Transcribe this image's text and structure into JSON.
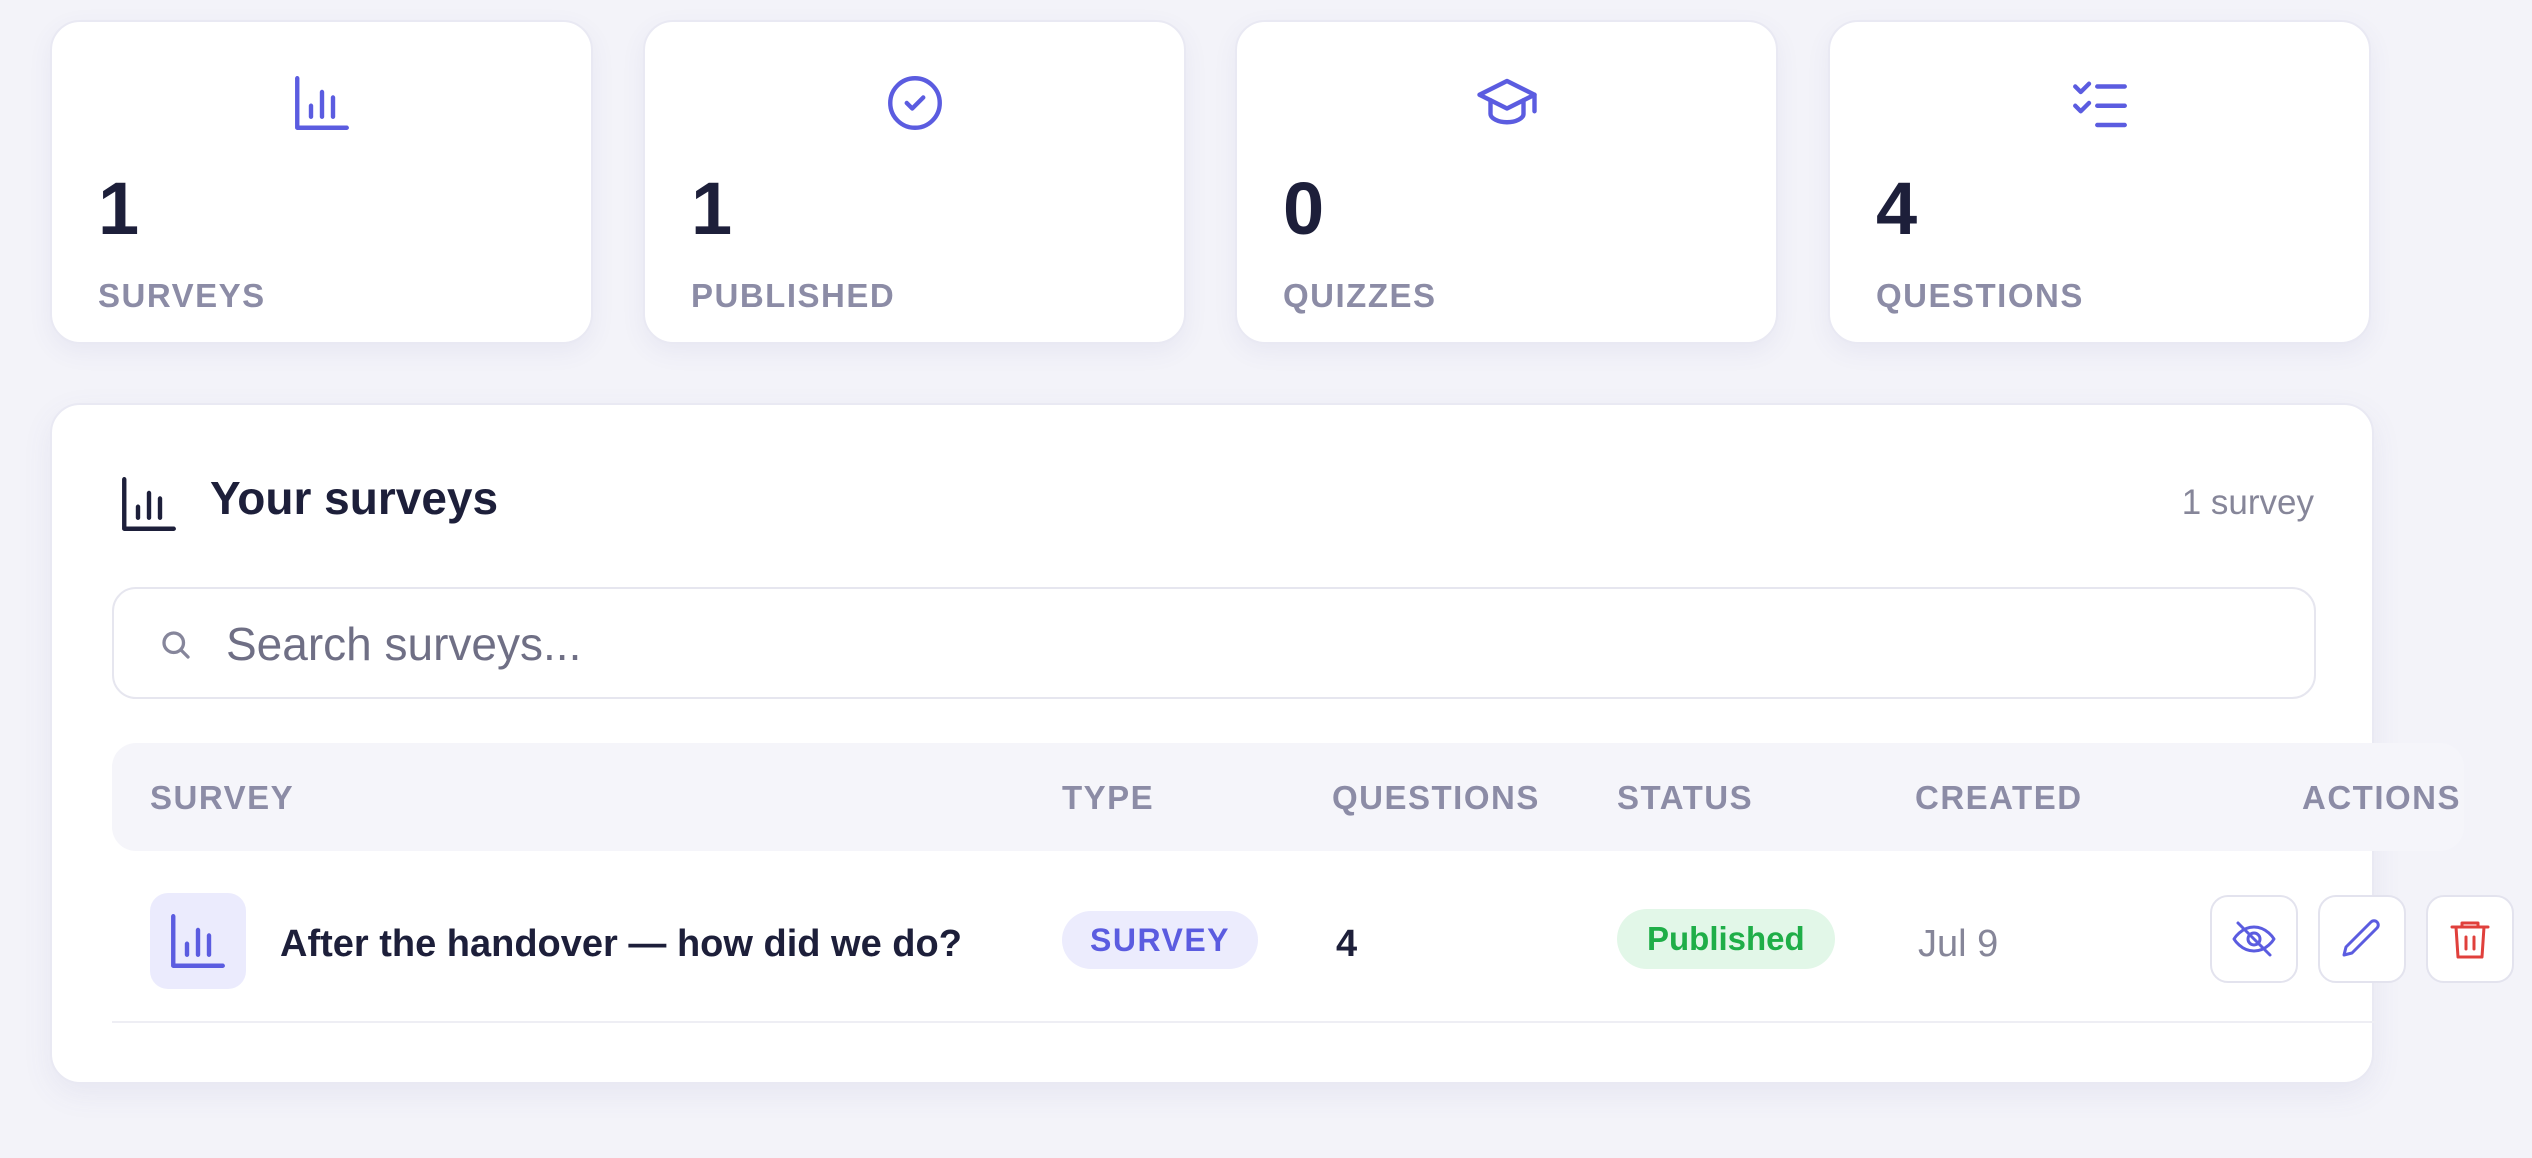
{
  "stats": [
    {
      "value": "1",
      "label": "SURVEYS",
      "icon": "bar-chart-icon"
    },
    {
      "value": "1",
      "label": "PUBLISHED",
      "icon": "check-circle-icon"
    },
    {
      "value": "0",
      "label": "QUIZZES",
      "icon": "graduation-cap-icon"
    },
    {
      "value": "4",
      "label": "QUESTIONS",
      "icon": "checklist-icon"
    }
  ],
  "panel": {
    "title": "Your surveys",
    "count": "1 survey",
    "icon": "bar-chart-icon"
  },
  "search": {
    "placeholder": "Search surveys...",
    "value": "",
    "icon": "search-icon"
  },
  "table": {
    "columns": [
      "SURVEY",
      "TYPE",
      "QUESTIONS",
      "STATUS",
      "CREATED",
      "ACTIONS"
    ],
    "rows": [
      {
        "title": "After the handover — how did we do?",
        "type": "SURVEY",
        "questions": "4",
        "status": "Published",
        "created": "Jul 9",
        "actions": [
          "eye-off-icon",
          "pencil-icon",
          "trash-icon"
        ]
      }
    ]
  },
  "colors": {
    "accent": "#5b5ce0",
    "published_bg": "#e2f7e8",
    "published_text": "#1fae48",
    "danger": "#e0403c",
    "background": "#f3f3f9"
  }
}
